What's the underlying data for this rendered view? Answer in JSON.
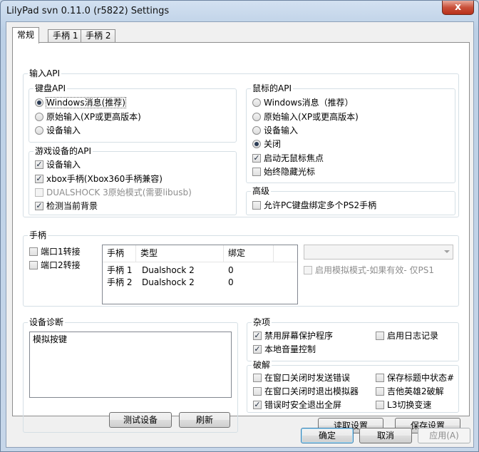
{
  "window": {
    "title": "LilyPad svn 0.11.0 (r5822)  Settings",
    "close_glyph": "x"
  },
  "tabs": [
    "常规",
    "手柄 1",
    "手柄 2"
  ],
  "input_api": {
    "label": "输入API",
    "keyboard": {
      "label": "键盘API",
      "options": [
        {
          "label": "Windows消息(推荐)",
          "selected": true
        },
        {
          "label": "原始输入(XP或更高版本)",
          "selected": false
        },
        {
          "label": "设备输入",
          "selected": false
        }
      ]
    },
    "gamedevice": {
      "label": "游戏设备的API",
      "options": [
        {
          "label": "设备输入",
          "checked": true,
          "disabled": false
        },
        {
          "label": "xbox手柄(Xbox360手柄兼容)",
          "checked": true,
          "disabled": false
        },
        {
          "label": "DUALSHOCK 3原始模式(需要libusb)",
          "checked": false,
          "disabled": true
        },
        {
          "label": "检测当前背景",
          "checked": true,
          "disabled": false
        }
      ]
    },
    "mouse": {
      "label": "鼠标的API",
      "options": [
        {
          "label": "Windows消息（推荐）",
          "selected": false
        },
        {
          "label": "原始输入(XP或更高版本)",
          "selected": false
        },
        {
          "label": "设备输入",
          "selected": false
        },
        {
          "label": "关闭",
          "selected": true
        }
      ],
      "checks": [
        {
          "label": "启动无鼠标焦点",
          "checked": true
        },
        {
          "label": "始终隐藏光标",
          "checked": false
        }
      ]
    },
    "advanced": {
      "label": "高级",
      "checks": [
        {
          "label": "允许PC键盘绑定多个PS2手柄",
          "checked": false
        }
      ]
    }
  },
  "pads": {
    "label": "手柄",
    "ports": [
      {
        "label": "端口1转接",
        "checked": false
      },
      {
        "label": "端口2转接",
        "checked": false
      }
    ],
    "columns": [
      "手柄",
      "类型",
      "绑定"
    ],
    "rows": [
      [
        "手柄 1",
        "Dualshock 2",
        "0"
      ],
      [
        "手柄 2",
        "Dualshock 2",
        "0"
      ]
    ],
    "combo_value": "",
    "emu_mode": {
      "label": "启用模拟模式-如果有效- 仅PS1",
      "checked": false
    }
  },
  "diag": {
    "label": "设备诊断",
    "items": [
      "模拟按键"
    ],
    "test_button": "测试设备",
    "refresh_button": "刷新"
  },
  "misc": {
    "label": "杂项",
    "checks": [
      {
        "label": "禁用屏幕保护程序",
        "checked": true
      },
      {
        "label": "启用日志记录",
        "checked": false
      },
      {
        "label": "本地音量控制",
        "checked": true
      }
    ]
  },
  "hacks": {
    "label": "破解",
    "checks": [
      {
        "label": "在窗口关闭时发送错误",
        "checked": false
      },
      {
        "label": "保存标题中状态#",
        "checked": false
      },
      {
        "label": "在窗口关闭时退出模拟器",
        "checked": false
      },
      {
        "label": "吉他英雄2破解",
        "checked": false
      },
      {
        "label": "错误时安全退出全屏",
        "checked": true
      },
      {
        "label": "L3切换变速",
        "checked": false
      }
    ]
  },
  "buttons": {
    "load": "读取设置",
    "save": "保存设置",
    "ok": "确定",
    "cancel": "取消",
    "apply": "应用(A)"
  },
  "colors": {
    "accent_blue": "#3c7fb1",
    "close_red": "#c9503a"
  }
}
